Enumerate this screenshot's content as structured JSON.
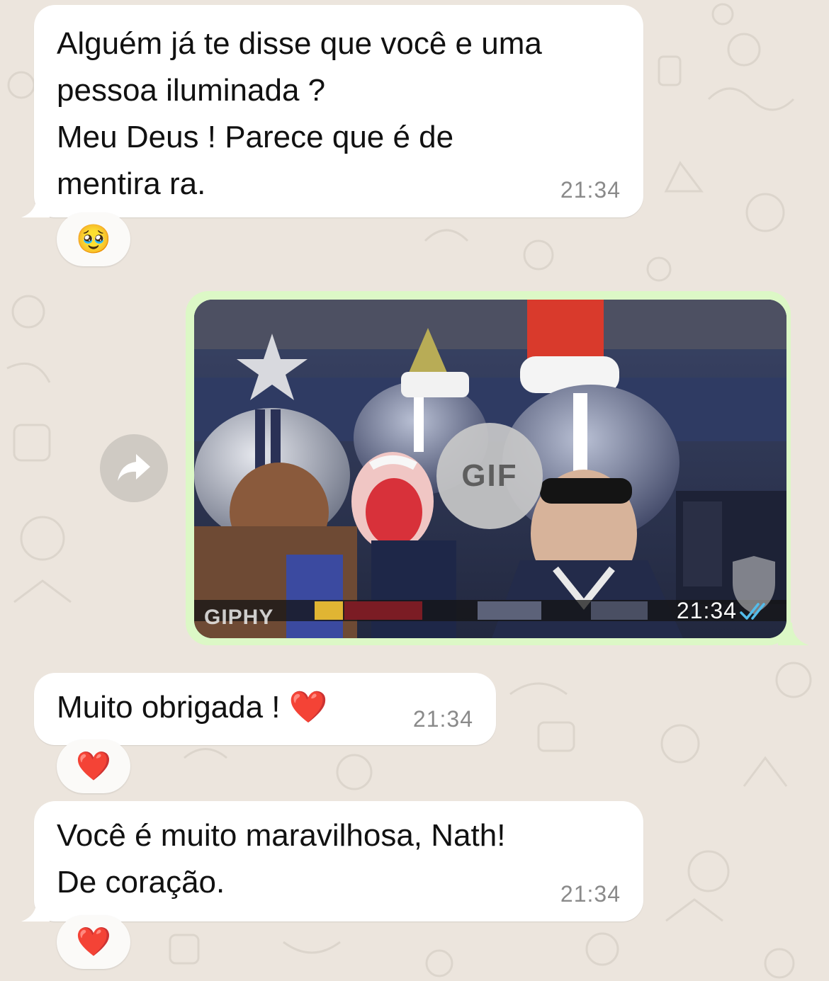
{
  "messages": [
    {
      "text": "Alguém já te disse que você e uma\npessoa iluminada ?\nMeu Deus ! Parece que é de\nmentira ra.",
      "time": "21:34",
      "reaction": "🥹"
    },
    {
      "text": "Muito obrigada ! ❤️",
      "time": "21:34",
      "reaction": "❤️"
    },
    {
      "text": "Você é muito maravilhosa, Nath!\nDe coração.",
      "time": "21:34",
      "reaction": "❤️"
    }
  ],
  "gif_message": {
    "badge": "GIF",
    "time": "21:34",
    "source_label": "GIPHY",
    "status": "read"
  },
  "colors": {
    "chat_background": "#ece5dd",
    "incoming_bubble": "#ffffff",
    "outgoing_bubble": "#dcf8c6",
    "read_ticks": "#53bdeb"
  },
  "icons": {
    "forward": "forward-arrow-icon",
    "read_receipt": "double-check-icon"
  }
}
